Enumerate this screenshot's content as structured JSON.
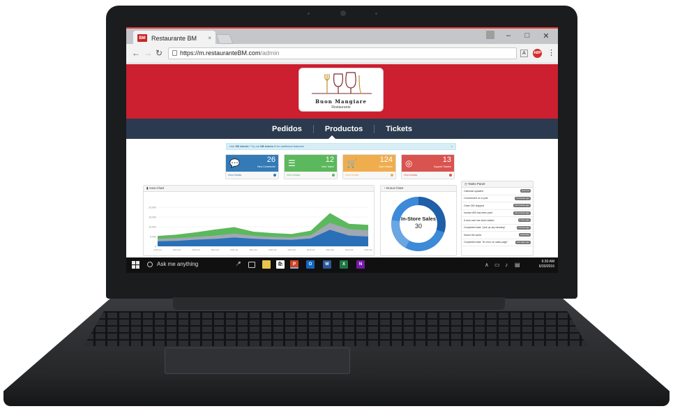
{
  "browser": {
    "tab_title": "Restaurante BM",
    "tab_badge": "BM",
    "url_host": "https://m.restauranteBM.com",
    "url_path": "/admin"
  },
  "brand": {
    "name": "Buon Mangiare",
    "subtitle": "Restaurante"
  },
  "nav": {
    "items": [
      "Pedidos",
      "Productos",
      "Tickets"
    ],
    "active": "Productos"
  },
  "alert": {
    "prefix": "Like",
    "product": "SB Admin",
    "middle": "? Try out",
    "upgrade": "SB Admin 2",
    "suffix": "for additional features!"
  },
  "stats": [
    {
      "value": "26",
      "label": "New Comments!",
      "footer": "View Details",
      "color": "#337ab7",
      "icon": "comments-icon"
    },
    {
      "value": "12",
      "label": "New Tasks!",
      "footer": "View Details",
      "color": "#5cb85c",
      "icon": "tasks-icon"
    },
    {
      "value": "124",
      "label": "New Orders!",
      "footer": "View Details",
      "color": "#f0ad4e",
      "icon": "cart-icon"
    },
    {
      "value": "13",
      "label": "Support Tickets!",
      "footer": "View Details",
      "color": "#d9534f",
      "icon": "support-icon"
    }
  ],
  "area_chart": {
    "title": "Area Chart",
    "y_ticks": [
      "20,000",
      "15,000",
      "10,000",
      "5,000",
      "0"
    ],
    "x_ticks": [
      "2010 Q1",
      "2010 Q2",
      "2010 Q3",
      "2010 Q4",
      "2011 Q1",
      "2011 Q2",
      "2011 Q3",
      "2011 Q4",
      "2012 Q1",
      "2012 Q2",
      "2012 Q3",
      "2012 Q4"
    ],
    "colors": [
      "#2a70b8",
      "#a0a8b4",
      "#5cb85c"
    ]
  },
  "chart_data": {
    "type": "area",
    "x": [
      "2010 Q1",
      "2010 Q2",
      "2010 Q3",
      "2010 Q4",
      "2011 Q1",
      "2011 Q2",
      "2011 Q3",
      "2011 Q4",
      "2012 Q1",
      "2012 Q2",
      "2012 Q3",
      "2012 Q4"
    ],
    "ylim": [
      0,
      25000
    ],
    "series": [
      {
        "values": [
          2600,
          2800,
          3400,
          3800,
          4500,
          3900,
          3500,
          3300,
          4000,
          8500,
          5500,
          5000
        ]
      },
      {
        "values": [
          3800,
          4200,
          4800,
          5500,
          6500,
          5400,
          4800,
          4600,
          5700,
          12000,
          8800,
          8200
        ]
      },
      {
        "values": [
          5300,
          6000,
          7200,
          8600,
          9800,
          7500,
          6800,
          6300,
          8000,
          17000,
          11500,
          11000
        ]
      }
    ]
  },
  "donut": {
    "title": "Donut Chart",
    "label": "In-Store Sales",
    "value": "30",
    "colors": [
      "#1f5fa8",
      "#3c8ad8",
      "#6aa6e2"
    ]
  },
  "tasks": {
    "title": "Tasks Panel",
    "items": [
      {
        "text": "Calendar updated",
        "time": "just now"
      },
      {
        "text": "Commented on a post",
        "time": "4 minutes ago"
      },
      {
        "text": "Order 392 shipped",
        "time": "23 minutes ago"
      },
      {
        "text": "Invoice 653 has been paid",
        "time": "46 minutes ago"
      },
      {
        "text": "A new user has been added",
        "time": "1 hour ago"
      },
      {
        "text": "Completed task: \"pick up dry cleaning\"",
        "time": "2 hours ago"
      },
      {
        "text": "Saved the world",
        "time": "yesterday"
      },
      {
        "text": "Completed task: \"fix error on sales page\"",
        "time": "two days ago"
      }
    ]
  },
  "taskbar": {
    "search_text": "Ask me anything",
    "time": "6:30 AM",
    "date": "6/30/2016"
  }
}
